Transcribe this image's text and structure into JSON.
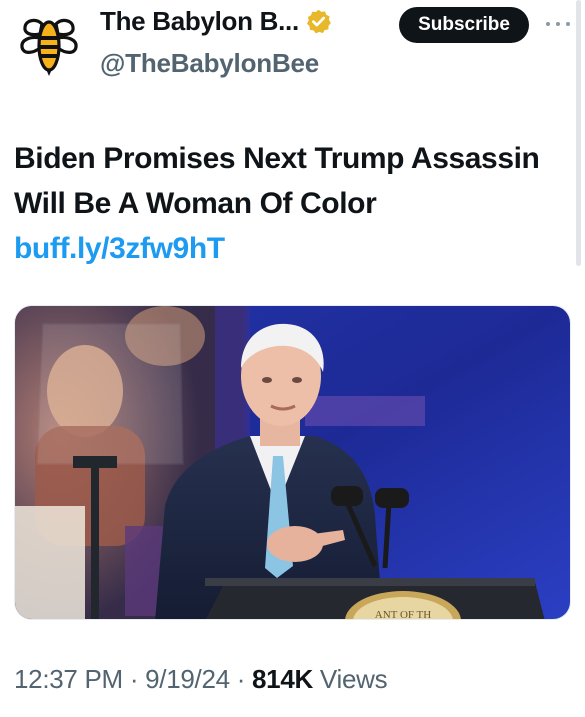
{
  "account": {
    "display_name": "The Babylon B...",
    "handle": "@TheBabylonBee",
    "avatar_icon": "babylon-bee-logo-icon",
    "verified_icon": "gold-verified-badge-icon",
    "verified_color": "#e8b82b"
  },
  "actions": {
    "subscribe_label": "Subscribe",
    "more_icon": "more-options-icon"
  },
  "tweet": {
    "text": "Biden Promises Next Trump Assassin Will Be A Woman Of Color",
    "link_text": "buff.ly/3zfw9hT",
    "media": {
      "podium_seal_text": "ANT OF TH"
    }
  },
  "meta": {
    "time": "12:37 PM",
    "date": "9/19/24",
    "views_count": "814K",
    "views_label": "Views"
  },
  "colors": {
    "text_primary": "#0f1419",
    "text_secondary": "#536471",
    "link": "#1d9bf0",
    "button_bg": "#0f1419"
  }
}
